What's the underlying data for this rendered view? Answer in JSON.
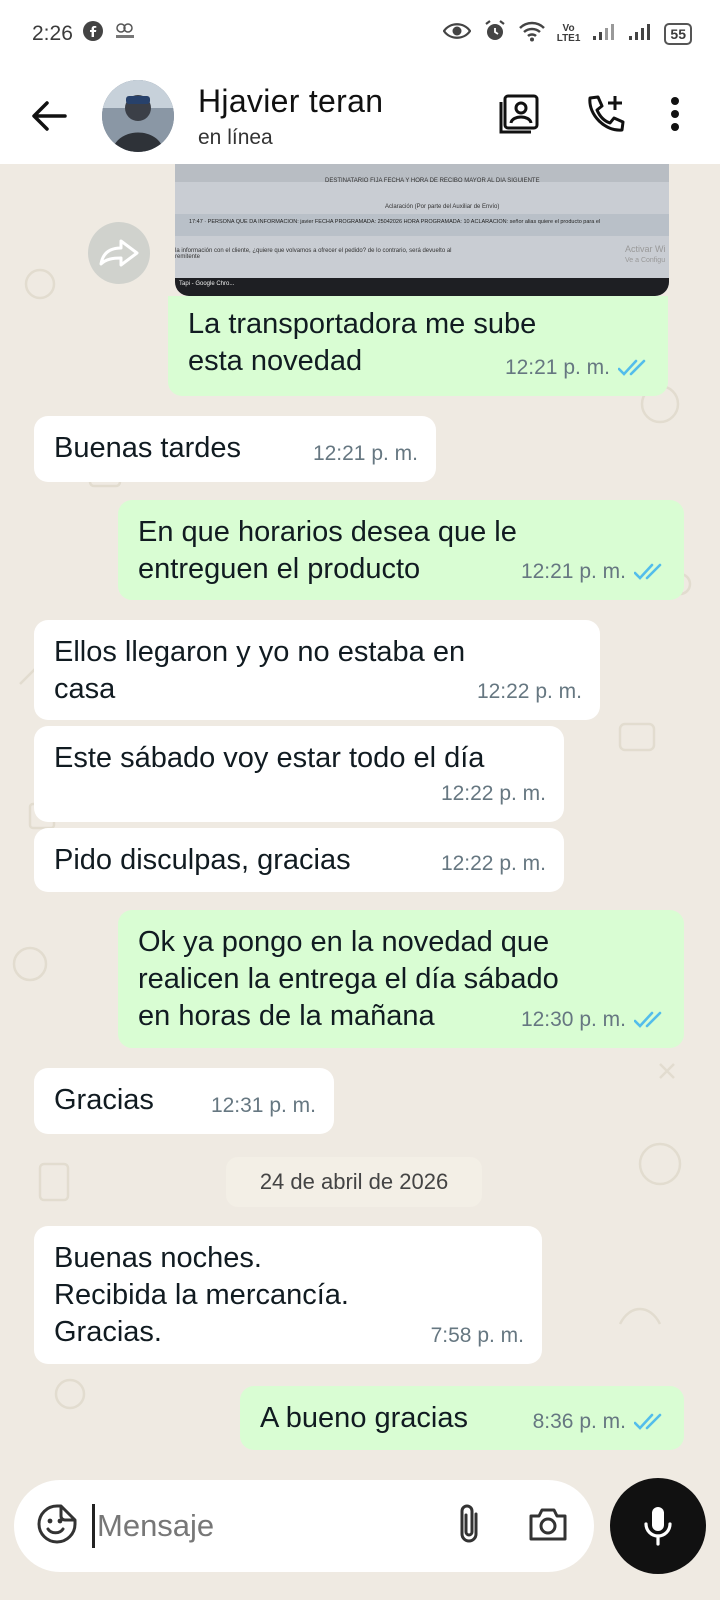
{
  "status_bar": {
    "time": "2:26",
    "lte_top": "Vo",
    "lte_bottom": "LTE1",
    "battery": "55"
  },
  "header": {
    "name": "Hjavier teran",
    "status": "en línea"
  },
  "image_message": {
    "lines": [
      "DESTINATARIO FIJA FECHA Y HORA DE RECIBO MAYOR AL DIA SIGUIENTE",
      "Aclaración (Por parte del Auxiliar de Envío)",
      "17:47 · PERSONA QUE DA INFORMACION: javier FECHA PROGRAMADA: 25042026 HORA PROGRAMADA: 10 ACLARACION: señor alias quiere el producto para el",
      "la información con el cliente, ¿quiere que volvamos a ofrecer el pedido? de lo contrario, será devuelto al remitente",
      "Activar Wi",
      "Ve a Configu",
      "Tapi - Google Chro..."
    ]
  },
  "messages": [
    {
      "dir": "out",
      "text": "La transportadora me sube\nesta novedad",
      "time": "12:21 p. m."
    },
    {
      "dir": "in",
      "text": "Buenas tardes",
      "time": "12:21 p. m."
    },
    {
      "dir": "out",
      "text": "En que horarios desea que le\nentreguen el producto",
      "time": "12:21 p. m."
    },
    {
      "dir": "in",
      "text": "Ellos llegaron y yo no estaba en\ncasa",
      "time": "12:22 p. m."
    },
    {
      "dir": "in",
      "text": "Este sábado voy estar todo el día",
      "time": "12:22 p. m."
    },
    {
      "dir": "in",
      "text": "Pido disculpas, gracias",
      "time": "12:22 p. m."
    },
    {
      "dir": "out",
      "text": "Ok ya pongo en la novedad que\nrealicen la entrega  el día sábado\nen horas de la mañana",
      "time": "12:30 p. m."
    },
    {
      "dir": "in",
      "text": "Gracias",
      "time": "12:31 p. m."
    },
    {
      "dir": "in",
      "text": "Buenas noches.\nRecibida la mercancía.\nGracias.",
      "time": "7:58 p. m."
    },
    {
      "dir": "out",
      "text": "A bueno gracias",
      "time": "8:36 p. m."
    }
  ],
  "date_divider": "24 de abril de 2026",
  "input": {
    "placeholder": "Mensaje"
  },
  "colors": {
    "outgoing": "#d9fdd3",
    "incoming": "#ffffff",
    "read_ticks": "#53bdeb",
    "background": "#efeae2"
  }
}
